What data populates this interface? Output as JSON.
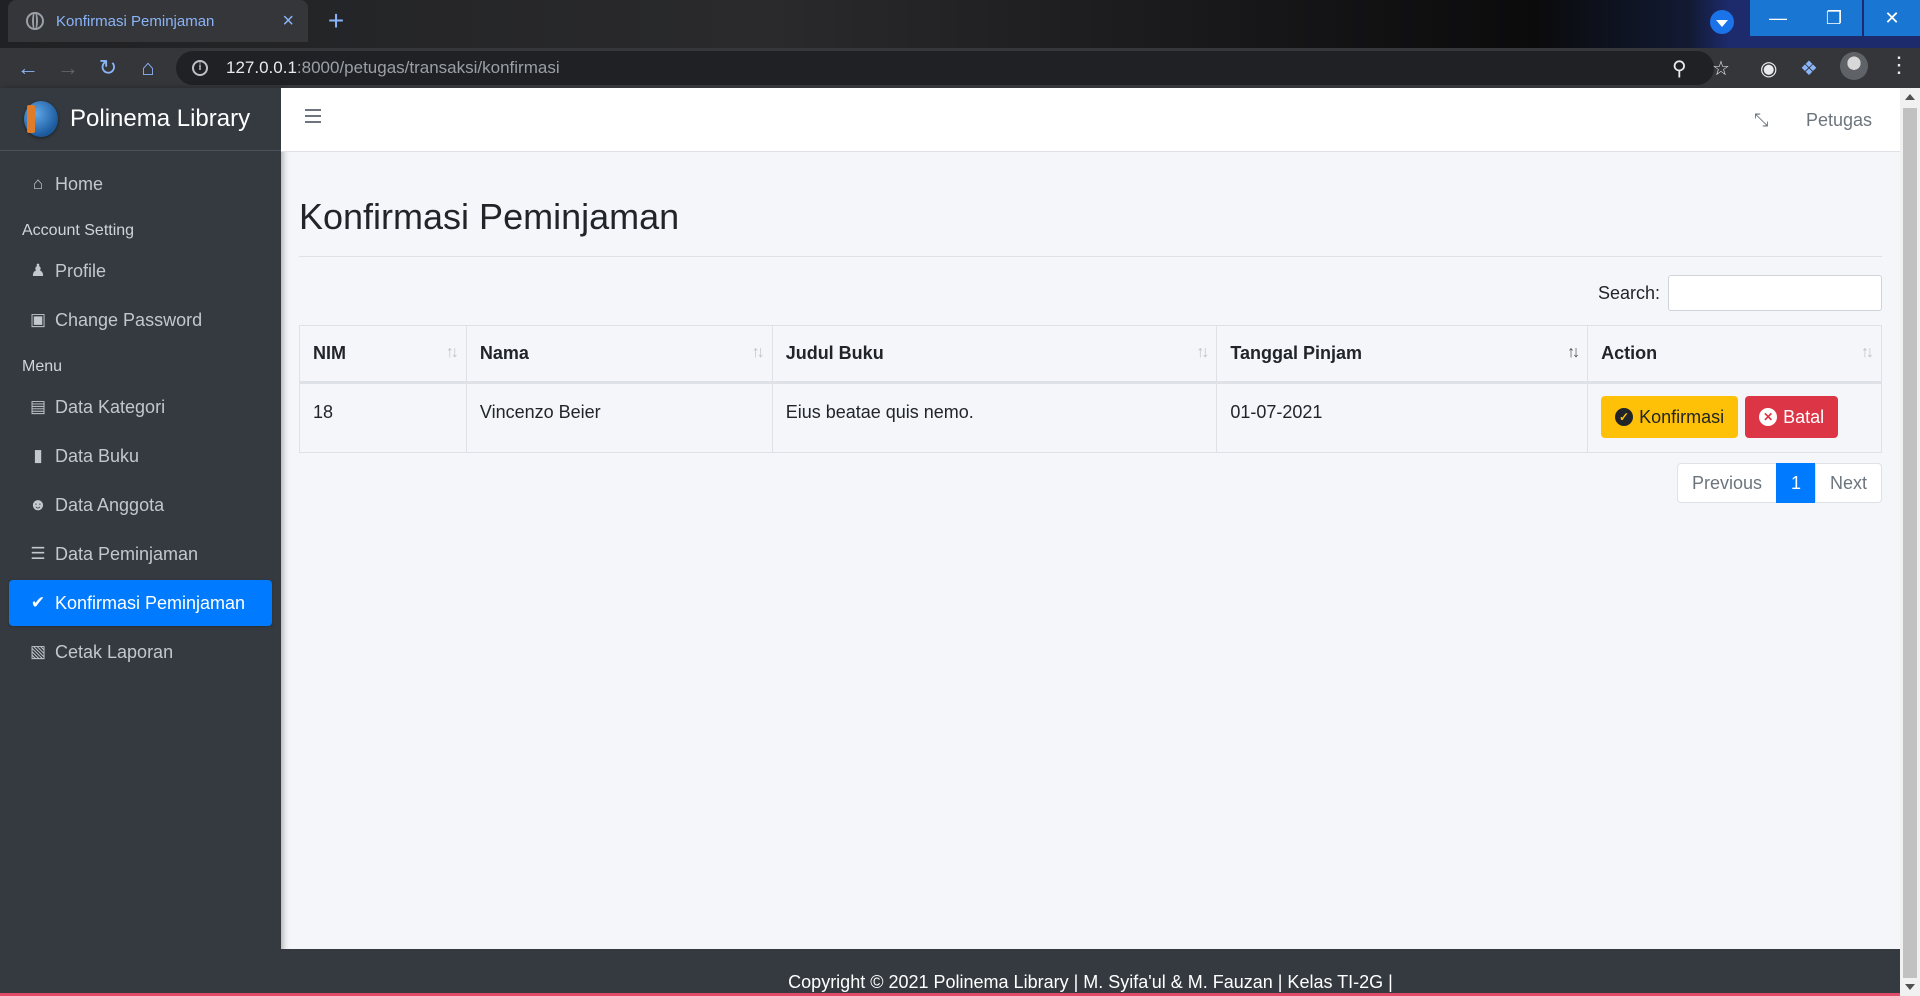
{
  "browser": {
    "tab_title": "Konfirmasi Peminjaman",
    "url_host": "127.0.0.1",
    "url_path": ":8000/petugas/transaksi/konfirmasi"
  },
  "sidebar": {
    "brand": "Polinema Library",
    "items": [
      {
        "label": "Home",
        "icon": "home-icon"
      },
      {
        "header": "Account Setting"
      },
      {
        "label": "Profile",
        "icon": "user-icon"
      },
      {
        "label": "Change Password",
        "icon": "lock-icon"
      },
      {
        "header": "Menu"
      },
      {
        "label": "Data Kategori",
        "icon": "book-open-icon"
      },
      {
        "label": "Data Buku",
        "icon": "book-icon"
      },
      {
        "label": "Data Anggota",
        "icon": "users-icon"
      },
      {
        "label": "Data Peminjaman",
        "icon": "database-icon"
      },
      {
        "label": "Konfirmasi Peminjaman",
        "icon": "check-circle-icon",
        "active": true
      },
      {
        "label": "Cetak Laporan",
        "icon": "file-pdf-icon"
      }
    ]
  },
  "topnav": {
    "user_label": "Petugas"
  },
  "main": {
    "title": "Konfirmasi Peminjaman",
    "search_label": "Search:",
    "table": {
      "columns": [
        "NIM",
        "Nama",
        "Judul Buku",
        "Tanggal Pinjam",
        "Action"
      ],
      "rows": [
        {
          "nim": "18",
          "nama": "Vincenzo Beier",
          "judul": "Eius beatae quis nemo.",
          "tanggal": "01-07-2021"
        }
      ],
      "confirm_label": "Konfirmasi",
      "cancel_label": "Batal"
    },
    "pagination": {
      "previous": "Previous",
      "current": "1",
      "next": "Next"
    }
  },
  "footer": {
    "text": "Copyright © 2021 Polinema Library | M. Syifa'ul & M. Fauzan | Kelas TI-2G |"
  },
  "colors": {
    "primary": "#007bff",
    "warning": "#ffc107",
    "danger": "#dc3545",
    "sidebar": "#343a40"
  }
}
